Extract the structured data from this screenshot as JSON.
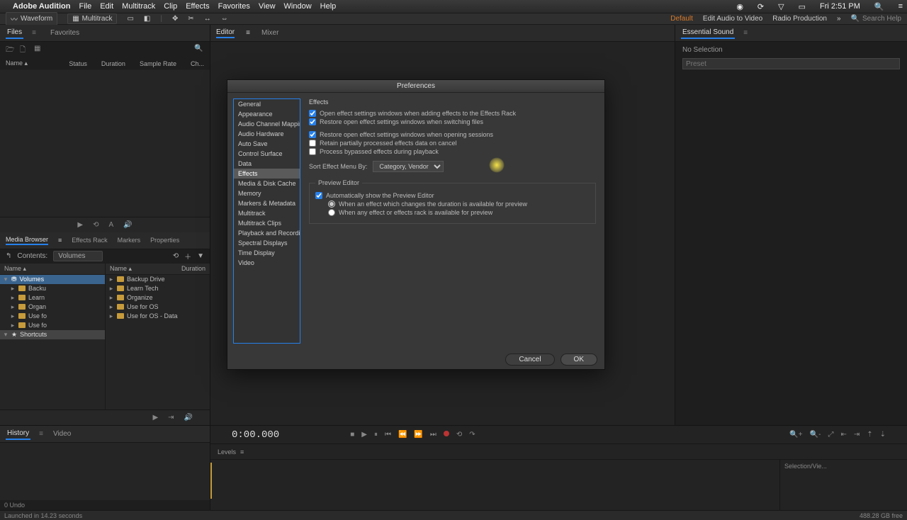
{
  "menubar": {
    "brand": "Adobe Audition",
    "items": [
      "File",
      "Edit",
      "Multitrack",
      "Clip",
      "Effects",
      "Favorites",
      "View",
      "Window",
      "Help"
    ],
    "clock": "Fri 2:51 PM"
  },
  "toolbar": {
    "waveform": "Waveform",
    "multitrack": "Multitrack",
    "workspaces": {
      "default": "Default",
      "audioVideo": "Edit Audio to Video",
      "radio": "Radio Production"
    },
    "search": "Search Help"
  },
  "files": {
    "tabs": {
      "files": "Files",
      "favorites": "Favorites"
    },
    "icons": {
      "open": "open-icon",
      "new": "new-icon",
      "search": "search-icon"
    },
    "cols": {
      "name": "Name ▴",
      "status": "Status",
      "duration": "Duration",
      "sampleRate": "Sample Rate",
      "channels": "Ch..."
    }
  },
  "mediaBrowser": {
    "tabs": {
      "mb": "Media Browser",
      "fx": "Effects Rack",
      "markers": "Markers",
      "props": "Properties"
    },
    "label": "Contents:",
    "sel": "Volumes",
    "col1": {
      "head": "Name ▴",
      "selRow": "Volumes",
      "rows": [
        "Backu",
        "Learn",
        "Organ",
        "Use fo",
        "Use fo"
      ],
      "short": "Shortcuts"
    },
    "col2": {
      "head1": "Name ▴",
      "head2": "Duration",
      "rows": [
        "Backup Drive",
        "Learn Tech",
        "Organize",
        "Use for OS",
        "Use for OS - Data"
      ]
    }
  },
  "editor": {
    "tabs": {
      "editor": "Editor",
      "mixer": "Mixer"
    }
  },
  "essential": {
    "title": "Essential Sound",
    "noSel": "No Selection",
    "preset": "Preset"
  },
  "history": {
    "tabs": {
      "history": "History",
      "video": "Video"
    },
    "undo": "0 Undo"
  },
  "timeline": {
    "time": "0:00.000",
    "levels": "Levels",
    "selview": "Selection/Vie...",
    "zoomIcons": [
      "zoom-in",
      "zoom-out",
      "zoom-full",
      "zoom-sel-in",
      "zoom-sel-out",
      "zoom-in-time",
      "zoom-out-time"
    ]
  },
  "statusbar": {
    "left": "Launched in 14.23 seconds",
    "right": "488.28 GB free"
  },
  "dialog": {
    "title": "Preferences",
    "categories": [
      "General",
      "Appearance",
      "Audio Channel Mapping",
      "Audio Hardware",
      "Auto Save",
      "Control Surface",
      "Data",
      "Effects",
      "Media & Disk Cache",
      "Memory",
      "Markers & Metadata",
      "Multitrack",
      "Multitrack Clips",
      "Playback and Recording",
      "Spectral Displays",
      "Time Display",
      "Video"
    ],
    "selectedCategory": "Effects",
    "heading": "Effects",
    "checks": {
      "c1": {
        "label": "Open effect settings windows when adding effects to the Effects Rack",
        "checked": true
      },
      "c2": {
        "label": "Restore open effect settings windows when switching files",
        "checked": true
      },
      "c3": {
        "label": "Restore open effect settings windows when opening sessions",
        "checked": true
      },
      "c4": {
        "label": "Retain partially processed effects data on cancel",
        "checked": false
      },
      "c5": {
        "label": "Process bypassed effects during playback",
        "checked": false
      }
    },
    "sortLabel": "Sort Effect Menu By:",
    "sortValue": "Category, Vendor",
    "preview": {
      "legend": "Preview Editor",
      "auto": {
        "label": "Automatically show the Preview Editor",
        "checked": true
      },
      "r1": {
        "label": "When an effect which changes the duration is available for preview",
        "checked": true
      },
      "r2": {
        "label": "When any effect or effects rack is available for preview",
        "checked": false
      }
    },
    "cancel": "Cancel",
    "ok": "OK"
  }
}
